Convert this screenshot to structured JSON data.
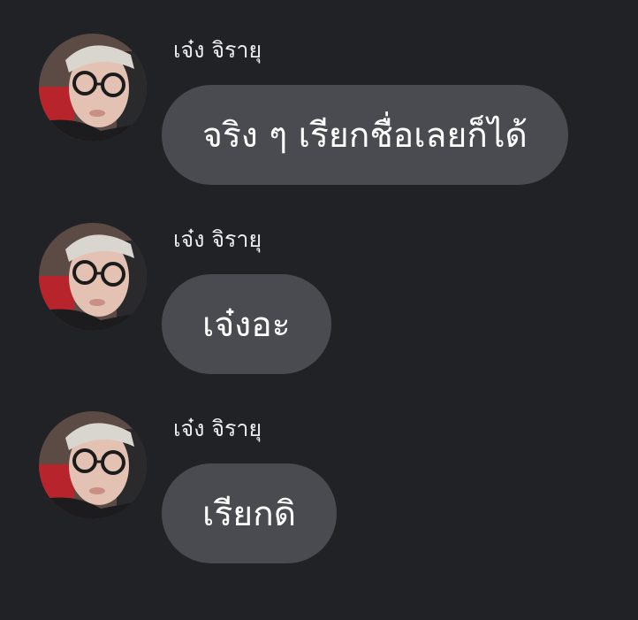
{
  "conversation": {
    "messages": [
      {
        "sender": "เจ๋ง จิรายุ",
        "avatar_icon": "user-avatar-photo",
        "text": "จริง ๆ เรียกชื่อเลยก็ได้"
      },
      {
        "sender": "เจ๋ง จิรายุ",
        "avatar_icon": "user-avatar-photo",
        "text": "เจ๋งอะ"
      },
      {
        "sender": "เจ๋ง จิรายุ",
        "avatar_icon": "user-avatar-photo",
        "text": "เรียกดิ"
      }
    ]
  },
  "colors": {
    "background": "#212226",
    "bubble": "#4a4b51",
    "text": "#ffffff",
    "sender_text": "#ececec"
  }
}
